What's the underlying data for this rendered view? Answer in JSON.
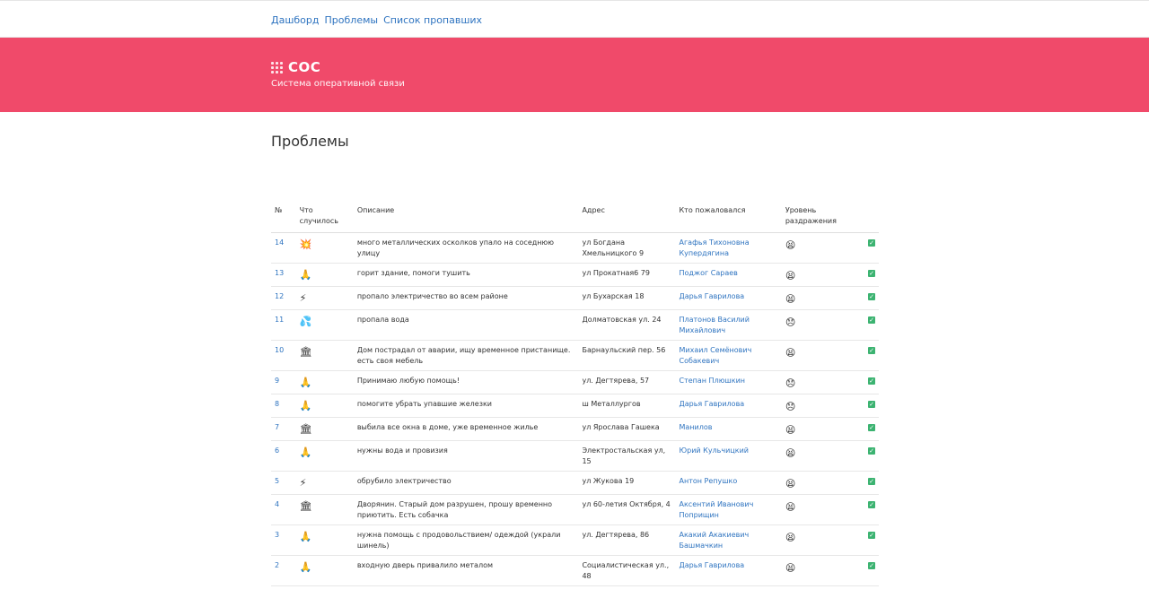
{
  "nav": {
    "items": [
      "Дашборд",
      "Проблемы",
      "Список пропавших"
    ]
  },
  "brand": {
    "title": "СОС",
    "subtitle": "Система оперативной связи"
  },
  "page": {
    "title": "Проблемы"
  },
  "colors": {
    "accent": "#f04a6a",
    "link": "#2f74c0",
    "check": "#3cb371"
  },
  "table": {
    "headers": [
      "№",
      "Что случилось",
      "Описание",
      "Адрес",
      "Кто пожаловался",
      "Уровень раздражения"
    ],
    "rows": [
      {
        "id": "14",
        "icon": "💥",
        "desc": "много металлических осколков упало на соседнюю улицу",
        "addr": "ул Богдана Хмельницкого 9",
        "who": "Агафья Тихоновна Купердягина",
        "level": "😫",
        "done": "✓"
      },
      {
        "id": "13",
        "icon": "🙏",
        "desc": "горит здание, помоги тушить",
        "addr": "ул Прокатная6 79",
        "who": "Поджог Сараев",
        "level": "😫",
        "done": "✓"
      },
      {
        "id": "12",
        "icon": "⚡",
        "desc": "пропало электричество во всем районе",
        "addr": "ул Бухарская 18",
        "who": "Дарья Гаврилова",
        "level": "😫",
        "done": "✓"
      },
      {
        "id": "11",
        "icon": "💦",
        "desc": "пропала вода",
        "addr": "Долматовская ул. 24",
        "who": "Платонов Василий Михайлович",
        "level": "😞",
        "done": "✓"
      },
      {
        "id": "10",
        "icon": "🏛",
        "desc": "Дом пострадал от аварии, ищу временное пристанище. есть своя мебель",
        "addr": "Барнаульский пер. 56",
        "who": "Михаил Семёнович Собакевич",
        "level": "😫",
        "done": "✓"
      },
      {
        "id": "9",
        "icon": "🙏",
        "desc": "Принимаю любую помощь!",
        "addr": "ул. Дегтярева, 57",
        "who": "Степан Плюшкин",
        "level": "😞",
        "done": "✓"
      },
      {
        "id": "8",
        "icon": "🙏",
        "desc": "помогите убрать упавшие железки",
        "addr": "ш Металлургов",
        "who": "Дарья Гаврилова",
        "level": "😞",
        "done": "✓"
      },
      {
        "id": "7",
        "icon": "🏛",
        "desc": "выбила все окна в доме, уже временное жилье",
        "addr": "ул Ярослава Гашека",
        "who": "Манилов",
        "level": "😫",
        "done": "✓"
      },
      {
        "id": "6",
        "icon": "🙏",
        "desc": "нужны вода и провизия",
        "addr": "Электростальская ул, 15",
        "who": "Юрий Кульчицкий",
        "level": "😫",
        "done": "✓"
      },
      {
        "id": "5",
        "icon": "⚡",
        "desc": "обрубило электричество",
        "addr": "ул Жукова 19",
        "who": "Антон Репушко",
        "level": "😫",
        "done": "✓"
      },
      {
        "id": "4",
        "icon": "🏛",
        "desc": "Дворянин. Старый дом разрушен, прошу временно приютить. Есть собачка",
        "addr": "ул 60-летия Октября, 4",
        "who": "Аксентий Иванович Поприщин",
        "level": "😫",
        "done": "✓"
      },
      {
        "id": "3",
        "icon": "🙏",
        "desc": "нужна помощь с продовольствием/ одеждой (украли шинель)",
        "addr": "ул. Дегтярева, 86",
        "who": "Акакий Акакиевич Башмачкин",
        "level": "😫",
        "done": "✓"
      },
      {
        "id": "2",
        "icon": "🙏",
        "desc": "входную дверь привалило металом",
        "addr": "Социалистическая ул., 48",
        "who": "Дарья Гаврилова",
        "level": "😫",
        "done": "✓"
      }
    ]
  }
}
